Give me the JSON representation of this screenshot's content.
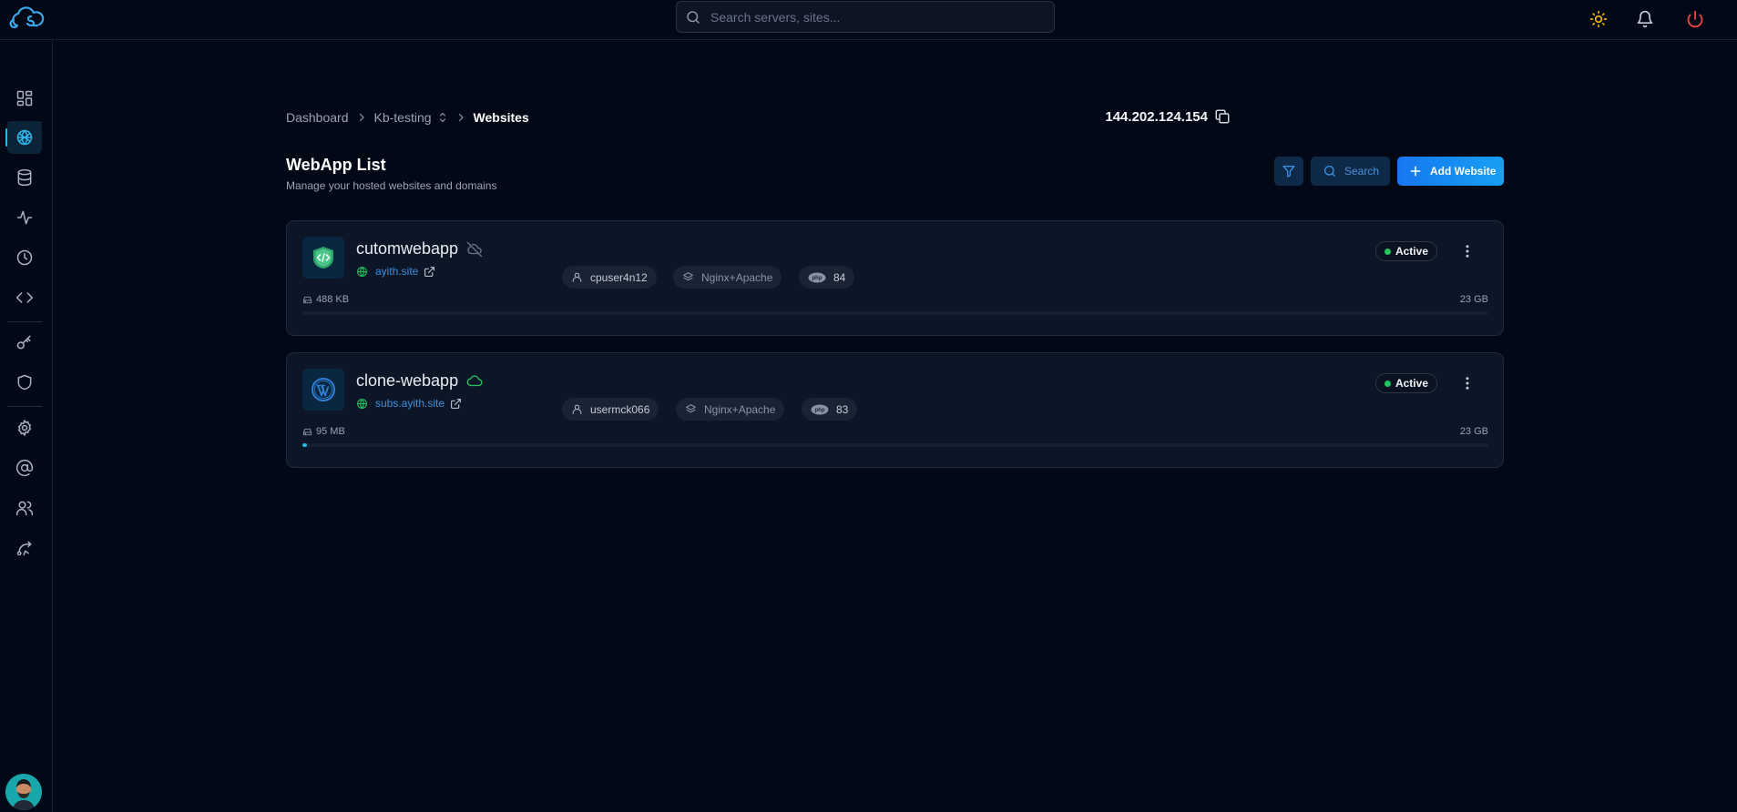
{
  "header": {
    "search_placeholder": "Search servers, sites..."
  },
  "breadcrumb": {
    "dashboard": "Dashboard",
    "server": "Kb-testing",
    "current": "Websites"
  },
  "server_ip": "144.202.124.154",
  "page": {
    "title": "WebApp List",
    "subtitle": "Manage your hosted websites and domains"
  },
  "toolbar": {
    "search_label": "Search",
    "add_label": "Add Website"
  },
  "colors": {
    "accent": "#22b8e8",
    "primary_button": "#1677f0",
    "active_green": "#22c55e",
    "danger": "#ef4444"
  },
  "webapps": [
    {
      "name": "cutomwebapp",
      "status_icon": "cloud-off-icon",
      "logo_icon": "custom-code-icon",
      "domain": "ayith.site",
      "user": "cpuser4n12",
      "stack": "Nginx+Apache",
      "php_version": "84",
      "status": "Active",
      "used": "488 KB",
      "total": "23 GB",
      "usage_fraction": 0.0
    },
    {
      "name": "clone-webapp",
      "status_icon": "cloud-icon",
      "logo_icon": "wordpress-icon",
      "domain": "subs.ayith.site",
      "user": "usermck066",
      "stack": "Nginx+Apache",
      "php_version": "83",
      "status": "Active",
      "used": "95 MB",
      "total": "23 GB",
      "usage_fraction": 0.004
    }
  ]
}
